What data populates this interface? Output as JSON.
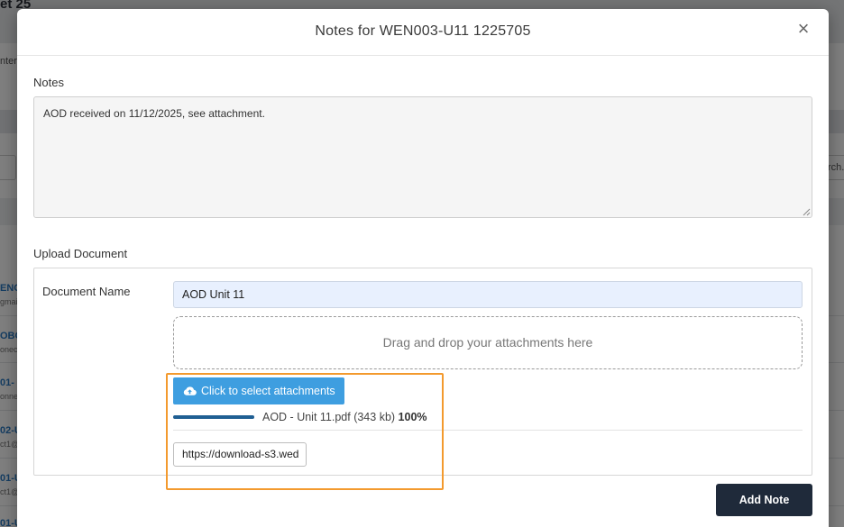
{
  "background": {
    "title_fragment": "et 25",
    "left_fragments": [
      "nter"
    ],
    "search_fragment": "rch.",
    "rows": [
      {
        "link": "ENC",
        "sub": "gmai"
      },
      {
        "link": "OBO",
        "sub": "onec"
      },
      {
        "link": "01-",
        "sub": "onne"
      },
      {
        "link": "02-U",
        "sub": "ct1@"
      },
      {
        "link": "01-U",
        "sub": "ct1@"
      },
      {
        "link": "01-U",
        "sub": ""
      }
    ]
  },
  "modal": {
    "title": "Notes for WEN003-U11 1225705",
    "close_symbol": "×",
    "notes_label": "Notes",
    "notes_value": "AOD received on 11/12/2025, see attachment.",
    "upload_label": "Upload Document",
    "document_name_label": "Document Name",
    "document_name_value": "AOD Unit 11",
    "dropzone_text": "Drag and drop your attachments here",
    "select_button_label": "Click to select attachments",
    "select_button_icon": "cloud-upload-icon",
    "file": {
      "name_size": "AOD - Unit 11.pdf (343 kb)",
      "percent_label": "100%",
      "progress": 1.0
    },
    "url_value": "https://download-s3.wed",
    "add_note_label": "Add Note"
  },
  "colors": {
    "primary_blue": "#3e9ee0",
    "dark_button": "#1f2a3a",
    "highlight_orange": "#f39a2e",
    "progress_fill": "#1f5f93",
    "autofill_bg": "#e8f0fe"
  }
}
